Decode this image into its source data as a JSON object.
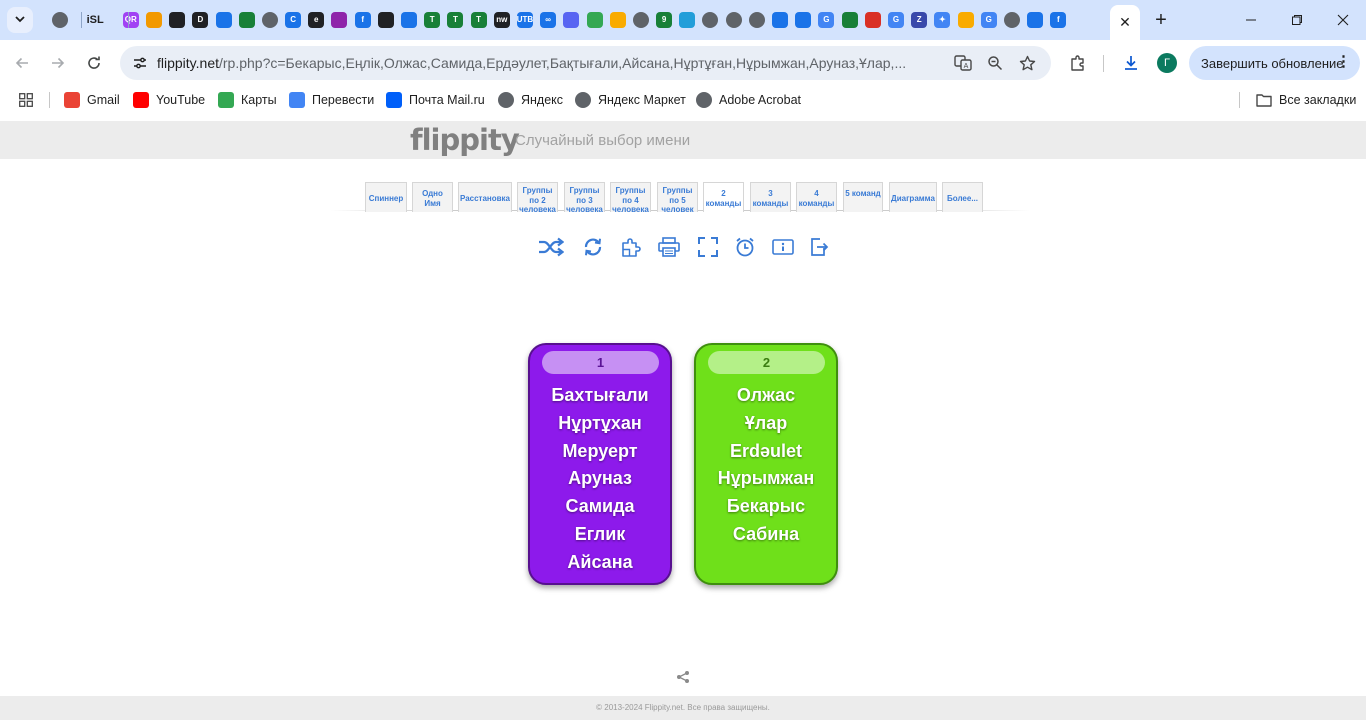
{
  "browser": {
    "pinned_tabs": [
      {
        "icon": "globe-icon",
        "label": "",
        "color": "#5f6368"
      },
      {
        "icon": "isl-icon",
        "label": "iSL",
        "color": "#1f1f1f"
      },
      {
        "icon": "qr-code-icon",
        "label": "QR",
        "color": "#a142f4"
      },
      {
        "icon": "paint-icon",
        "label": "",
        "color": "#f29900"
      },
      {
        "icon": "circle-c-icon",
        "label": "",
        "color": "#202124"
      },
      {
        "icon": "dd-icon",
        "label": "D",
        "color": "#202124"
      },
      {
        "icon": "download-icon",
        "label": "",
        "color": "#1a73e8"
      },
      {
        "icon": "green-download-icon",
        "label": "",
        "color": "#188038"
      },
      {
        "icon": "globe-icon",
        "label": "",
        "color": "#5f6368"
      },
      {
        "icon": "c-icon",
        "label": "C",
        "color": "#1a73e8"
      },
      {
        "icon": "e-icon",
        "label": "e",
        "color": "#202124"
      },
      {
        "icon": "purple-app-icon",
        "label": "",
        "color": "#8e24aa"
      },
      {
        "icon": "f-circle-icon",
        "label": "f",
        "color": "#1a73e8"
      },
      {
        "icon": "dots-icon",
        "label": "",
        "color": "#202124"
      },
      {
        "icon": "arrows-icon",
        "label": "",
        "color": "#1a73e8"
      },
      {
        "icon": "green-t-icon",
        "label": "T",
        "color": "#188038"
      },
      {
        "icon": "green-t-icon",
        "label": "T",
        "color": "#188038"
      },
      {
        "icon": "green-t-icon",
        "label": "T",
        "color": "#188038"
      },
      {
        "icon": "nw-icon",
        "label": "nw",
        "color": "#202124"
      },
      {
        "icon": "utb-icon",
        "label": "UTB",
        "color": "#1a73e8"
      },
      {
        "icon": "infinity-icon",
        "label": "∞",
        "color": "#1a73e8"
      },
      {
        "icon": "discord-icon",
        "label": "",
        "color": "#5865f2"
      },
      {
        "icon": "leaf-icon",
        "label": "",
        "color": "#34a853"
      },
      {
        "icon": "star-badge-icon",
        "label": "",
        "color": "#f9ab00"
      },
      {
        "icon": "globe-icon",
        "label": "",
        "color": "#5f6368"
      },
      {
        "icon": "nine-icon",
        "label": "9",
        "color": "#188038"
      },
      {
        "icon": "telegram-icon",
        "label": "",
        "color": "#229ed9"
      },
      {
        "icon": "globe-icon",
        "label": "",
        "color": "#5f6368"
      },
      {
        "icon": "globe-icon",
        "label": "",
        "color": "#5f6368"
      },
      {
        "icon": "ring-icon",
        "label": "",
        "color": "#5f6368"
      },
      {
        "icon": "mail-icon",
        "label": "",
        "color": "#1a73e8"
      },
      {
        "icon": "mail-icon",
        "label": "",
        "color": "#1a73e8"
      },
      {
        "icon": "google-icon",
        "label": "G",
        "color": "#4285f4"
      },
      {
        "icon": "chart-icon",
        "label": "",
        "color": "#188038"
      },
      {
        "icon": "pdf-icon",
        "label": "",
        "color": "#d93025"
      },
      {
        "icon": "google-icon",
        "label": "G",
        "color": "#4285f4"
      },
      {
        "icon": "z-icon",
        "label": "Z",
        "color": "#3949ab"
      },
      {
        "icon": "sparkle-icon",
        "label": "✦",
        "color": "#4285f4"
      },
      {
        "icon": "sign-icon",
        "label": "",
        "color": "#f9ab00"
      },
      {
        "icon": "google-icon",
        "label": "G",
        "color": "#4285f4"
      },
      {
        "icon": "globe-icon",
        "label": "",
        "color": "#5f6368"
      },
      {
        "icon": "grid-app-icon",
        "label": "",
        "color": "#1a73e8"
      },
      {
        "icon": "flippity-icon",
        "label": "f",
        "color": "#1a73e8"
      }
    ],
    "active_tab_close": "✕",
    "new_tab": "+",
    "url_domain": "flippity.net",
    "url_path": "/rp.php?c=Бекарыс,Еңлік,Олжас,Самида,Ердәулет,Бақтығали,Айсана,Нұртұған,Нұрымжан,Аруназ,Ұлар,...",
    "avatar_letter": "Г",
    "update_button": "Завершить обновление"
  },
  "bookmarks": {
    "items": [
      {
        "label": "Gmail",
        "icon": "gmail-icon",
        "color": "#ea4335"
      },
      {
        "label": "YouTube",
        "icon": "youtube-icon",
        "color": "#ff0000"
      },
      {
        "label": "Карты",
        "icon": "maps-icon",
        "color": "#34a853"
      },
      {
        "label": "Перевести",
        "icon": "translate-icon",
        "color": "#4285f4"
      },
      {
        "label": "Почта Mail.ru",
        "icon": "mailru-icon",
        "color": "#005ff9"
      },
      {
        "label": "Яндекс",
        "icon": "globe-icon",
        "color": "#5f6368"
      },
      {
        "label": "Яндекс Маркет",
        "icon": "globe-icon",
        "color": "#5f6368"
      },
      {
        "label": "Adobe Acrobat",
        "icon": "globe-icon",
        "color": "#5f6368"
      }
    ],
    "all_bookmarks": "Все закладки"
  },
  "page": {
    "logo": "flippity",
    "subtitle": "Случайный выбор имени",
    "tabs": [
      {
        "label": "Спиннер",
        "active": false
      },
      {
        "label": "Одно Имя",
        "active": false
      },
      {
        "label": "Расстановка",
        "active": false
      },
      {
        "label": "Группы по 2 человека",
        "active": false
      },
      {
        "label": "Группы по 3 человека",
        "active": false
      },
      {
        "label": "Группы по 4 человека",
        "active": false
      },
      {
        "label": "Группы по 5 человек",
        "active": false
      },
      {
        "label": "2 команды",
        "active": true
      },
      {
        "label": "3 команды",
        "active": false
      },
      {
        "label": "4 команды",
        "active": false
      },
      {
        "label": "5 команд",
        "active": false
      },
      {
        "label": "Диаграмма",
        "active": false
      },
      {
        "label": "Более...",
        "active": false
      }
    ],
    "tools": [
      "shuffle-icon",
      "refresh-icon",
      "puzzle-icon",
      "print-icon",
      "fullscreen-icon",
      "timer-icon",
      "info-icon",
      "export-icon"
    ],
    "accent_color": "#3a7bd5",
    "groups": [
      {
        "number": "1",
        "color": "#8d1aeb",
        "names": [
          "Бахтығали",
          "Нұртұхан",
          "Меруерт",
          "Аруназ",
          "Самида",
          "Еглик",
          "Айсана"
        ]
      },
      {
        "number": "2",
        "color": "#6fe01a",
        "names": [
          "Олжас",
          "Ұлар",
          "Erdəulet",
          "Нұрымжан",
          "Бекарыс",
          "Сабина"
        ]
      }
    ],
    "footer": "© 2013-2024 Flippity.net. Все права защищены."
  }
}
